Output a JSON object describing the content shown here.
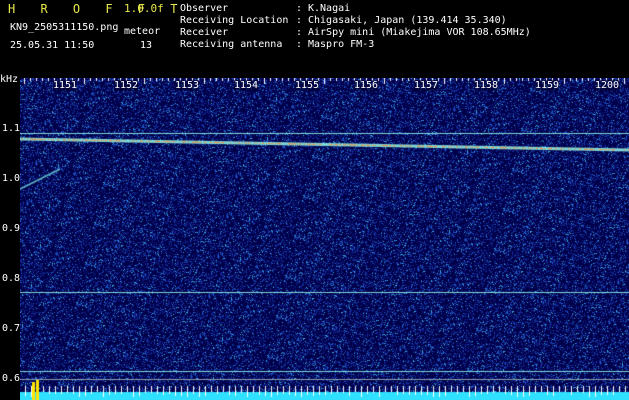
{
  "header": {
    "brand": "H R O F F T",
    "version": "1.0.0f",
    "filename": "KN9_2505311150.png",
    "mode": "meteor",
    "datetime": "25.05.31 11:50",
    "count": "13"
  },
  "info": [
    {
      "key": "Observer",
      "value": "K.Nagai"
    },
    {
      "key": "Receiving Location",
      "value": "Chigasaki, Japan (139.414 35.340)"
    },
    {
      "key": "Receiver",
      "value": "AirSpy mini (Miakejima VOR 108.65MHz)"
    },
    {
      "key": "Receiving antenna",
      "value": "Maspro FM-3"
    }
  ],
  "colon": ":",
  "axis": {
    "y_unit": "kHz",
    "y_ticks": [
      "1.1",
      "1.0",
      "0.9",
      "0.8",
      "0.7",
      "0.6"
    ],
    "x_ticks": [
      "1151",
      "1152",
      "1153",
      "1154",
      "1155",
      "1156",
      "1157",
      "1158",
      "1159",
      "1200"
    ]
  },
  "colors": {
    "background": "#00004a",
    "header_text": "#e8e84a",
    "carrier": "#7fd8d8",
    "trail": "#ff8a2a",
    "bottom_band": "#2fe0ff",
    "indicator": "#ffe600"
  },
  "signals": {
    "carrier_khz": [
      1.093,
      0.775,
      0.617
    ],
    "trail_start_khz": 1.08,
    "trail_end_khz": 1.058,
    "echo_start_khz": 0.98,
    "echo_end_khz": 1.02
  }
}
